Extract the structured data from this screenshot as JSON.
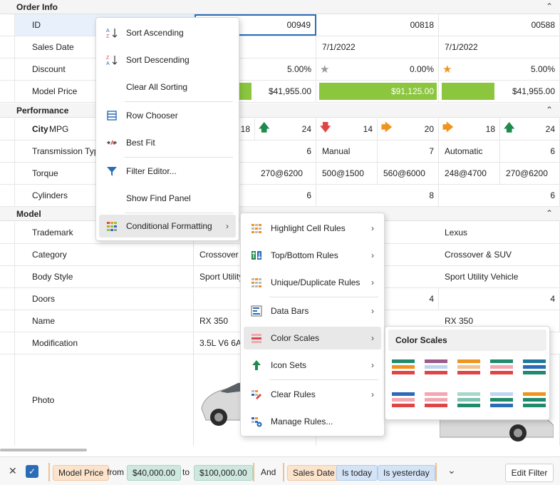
{
  "groups": {
    "order_info": "Order Info",
    "performance": "Performance",
    "model": "Model"
  },
  "rows": {
    "id": {
      "label": "ID",
      "values": [
        "00949",
        "00818",
        "00588"
      ]
    },
    "sales_date": {
      "label": "Sales Date",
      "values": [
        "",
        "7/1/2022",
        "7/1/2022"
      ]
    },
    "discount": {
      "label": "Discount",
      "values": [
        "5.00%",
        "0.00%",
        "5.00%"
      ]
    },
    "model_price": {
      "label": "Model Price",
      "values": [
        "$41,955.00",
        "$91,125.00",
        "$41,955.00"
      ]
    },
    "mpg": {
      "label": "MPG",
      "label_bold": "City",
      "values": [
        "18",
        "24",
        "14",
        "20",
        "18",
        "24"
      ]
    },
    "transmission": {
      "label": "Transmission Type",
      "values": [
        "6",
        "Manual",
        "7",
        "Automatic",
        "6"
      ]
    },
    "torque": {
      "label": "Torque",
      "values": [
        "270@6200",
        "500@1500",
        "560@6000",
        "248@4700",
        "270@6200"
      ]
    },
    "cylinders": {
      "label": "Cylinders",
      "values": [
        "6",
        "8",
        "6"
      ]
    },
    "trademark": {
      "label": "Trademark",
      "values": [
        "Lexus"
      ]
    },
    "category": {
      "label": "Category",
      "values": [
        "Crossover &",
        "Crossover & SUV"
      ]
    },
    "body_style": {
      "label": "Body Style",
      "values": [
        "Sport Utility",
        "Sport Utility Vehicle"
      ]
    },
    "doors": {
      "label": "Doors",
      "values": [
        "4",
        "4"
      ]
    },
    "name": {
      "label": "Name",
      "values": [
        "RX 350",
        "RX 350"
      ]
    },
    "modification": {
      "label": "Modification",
      "values": [
        "3.5L V6 6A"
      ]
    },
    "photo": {
      "label": "Photo"
    }
  },
  "context_menu": {
    "sort_asc": "Sort Ascending",
    "sort_desc": "Sort Descending",
    "clear_sorting": "Clear All Sorting",
    "row_chooser": "Row Chooser",
    "best_fit": "Best Fit",
    "filter_editor": "Filter Editor...",
    "find_panel": "Show Find Panel",
    "cond_format": "Conditional Formatting"
  },
  "cf_menu": {
    "highlight": "Highlight Cell Rules",
    "topbottom": "Top/Bottom Rules",
    "unique": "Unique/Duplicate Rules",
    "databars": "Data Bars",
    "colorscales": "Color Scales",
    "iconsets": "Icon Sets",
    "clear": "Clear Rules",
    "manage": "Manage Rules..."
  },
  "color_scales": {
    "title": "Color Scales"
  },
  "filter": {
    "field1": "Model Price",
    "from": "from",
    "v1": "$40,000.00",
    "to": "to",
    "v2": "$100,000.00",
    "and": "And",
    "field2": "Sales Date",
    "op1": "Is today",
    "op2": "Is yesterday",
    "edit": "Edit Filter"
  },
  "colors": {
    "accent": "#2b6cb8",
    "bar": "#8cc63f",
    "green_arrow": "#1f8a4c",
    "red_arrow": "#e04545",
    "orange_arrow": "#f0941e"
  }
}
